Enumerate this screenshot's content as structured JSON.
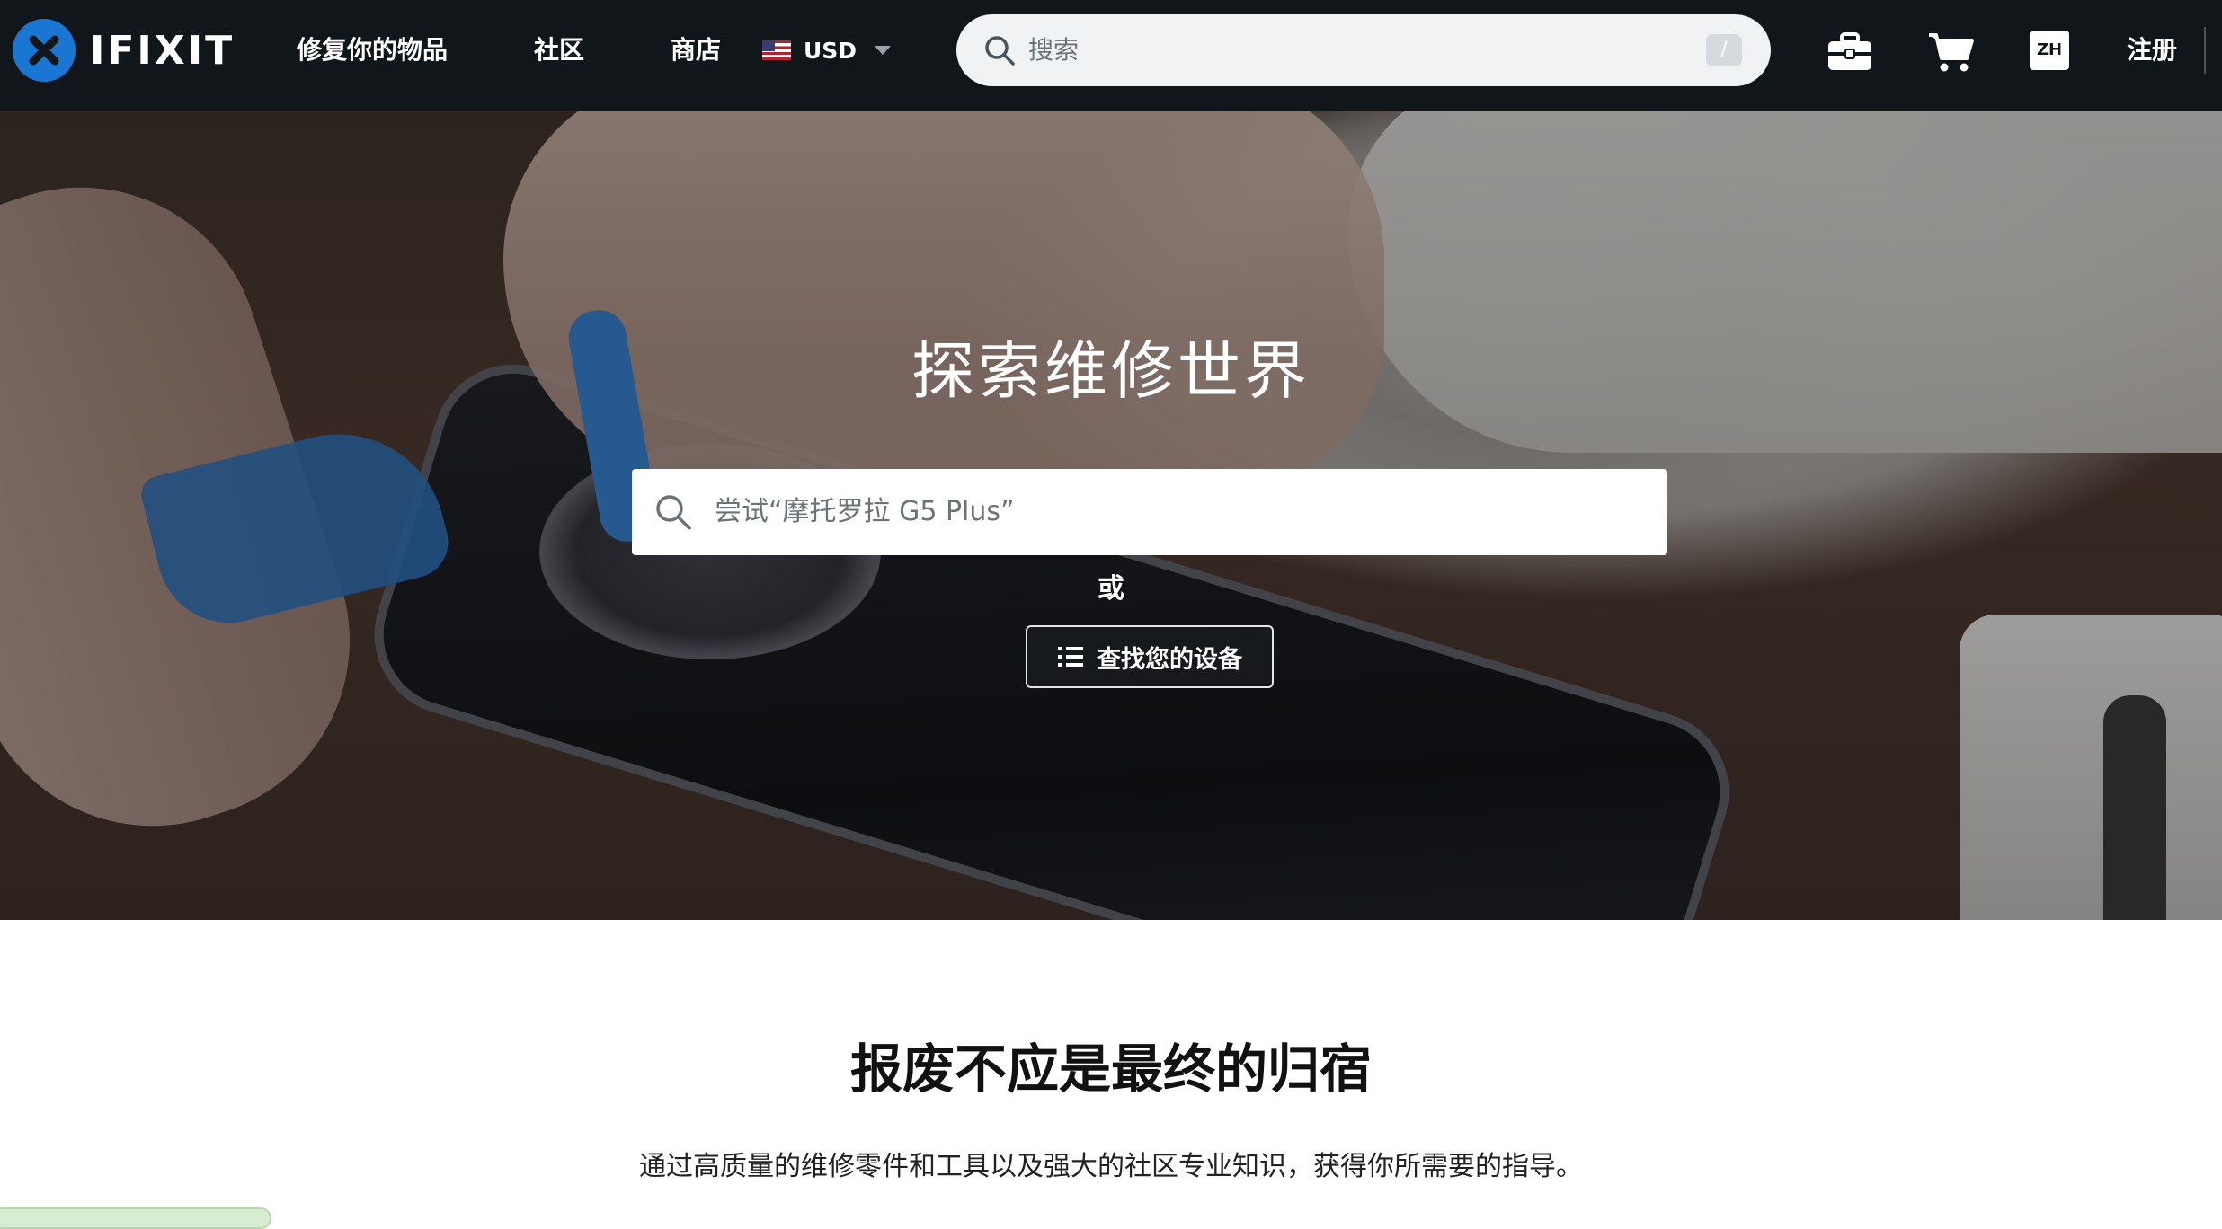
{
  "brand": {
    "name": "IFIXIT",
    "accent": "#1976d2"
  },
  "nav": {
    "links": [
      "修复你的物品",
      "社区",
      "商店"
    ],
    "currency": "USD",
    "search_placeholder": "搜索",
    "search_shortcut": "/",
    "language": "ZH",
    "signup": "注册",
    "icons": [
      "toolbox-icon",
      "cart-icon"
    ]
  },
  "hero": {
    "title": "探索维修世界",
    "search_placeholder": "尝试“摩托罗拉 G5 Plus”",
    "or": "或",
    "find_device": "查找您的设备"
  },
  "section": {
    "title": "报废不应是最终的归宿",
    "subtitle": "通过高质量的维修零件和工具以及强大的社区专业知识，获得你所需要的指导。"
  }
}
